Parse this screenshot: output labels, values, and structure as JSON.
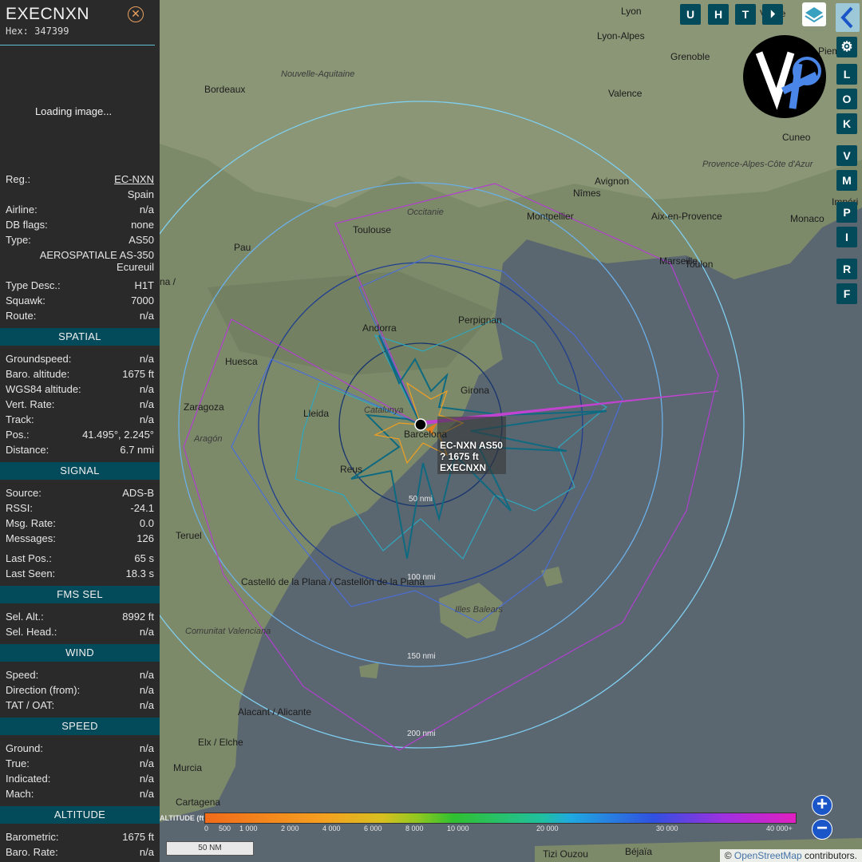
{
  "aircraft": {
    "callsign": "EXECNXN",
    "hex": "Hex: 347399",
    "loading": "Loading image..."
  },
  "info": {
    "reg_k": "Reg.:",
    "reg_v": "EC-NXN",
    "country": "Spain",
    "airline_k": "Airline:",
    "airline_v": "n/a",
    "dbflags_k": "DB flags:",
    "dbflags_v": "none",
    "type_k": "Type:",
    "type_v": "AS50",
    "type_full": "AEROSPATIALE AS-350\nEcureuil",
    "typedesc_k": "Type Desc.:",
    "typedesc_v": "H1T",
    "squawk_k": "Squawk:",
    "squawk_v": "7000",
    "route_k": "Route:",
    "route_v": "n/a"
  },
  "spatial": {
    "title": "SPATIAL",
    "rows": [
      [
        "Groundspeed:",
        "n/a"
      ],
      [
        "Baro. altitude:",
        "1675 ft"
      ],
      [
        "WGS84 altitude:",
        "n/a"
      ],
      [
        "Vert. Rate:",
        "n/a"
      ],
      [
        "Track:",
        "n/a"
      ],
      [
        "Pos.:",
        "41.495°, 2.245°"
      ],
      [
        "Distance:",
        "6.7 nmi"
      ]
    ]
  },
  "signal": {
    "title": "SIGNAL",
    "rows": [
      [
        "Source:",
        "ADS-B"
      ],
      [
        "RSSI:",
        "-24.1"
      ],
      [
        "Msg. Rate:",
        "0.0"
      ],
      [
        "Messages:",
        "126"
      ],
      [
        "Last Pos.:",
        "65 s"
      ],
      [
        "Last Seen:",
        "18.3 s"
      ]
    ]
  },
  "fms": {
    "title": "FMS SEL",
    "rows": [
      [
        "Sel. Alt.:",
        "8992 ft"
      ],
      [
        "Sel. Head.:",
        "n/a"
      ]
    ]
  },
  "wind": {
    "title": "WIND",
    "rows": [
      [
        "Speed:",
        "n/a"
      ],
      [
        "Direction (from):",
        "n/a"
      ],
      [
        "TAT / OAT:",
        "n/a"
      ]
    ]
  },
  "speed": {
    "title": "SPEED",
    "rows": [
      [
        "Ground:",
        "n/a"
      ],
      [
        "True:",
        "n/a"
      ],
      [
        "Indicated:",
        "n/a"
      ],
      [
        "Mach:",
        "n/a"
      ]
    ]
  },
  "altitude": {
    "title": "ALTITUDE",
    "rows": [
      [
        "Barometric:",
        "1675 ft"
      ],
      [
        "Baro. Rate:",
        "n/a"
      ]
    ]
  },
  "map": {
    "places": [
      "Lyon",
      "Grenoble",
      "Valence",
      "Bordeaux",
      "Nouvelle-Aquitaine",
      "Avignon",
      "Nîmes",
      "Provence-Alpes-Côte d'Azur",
      "Cuneo",
      "Toulouse",
      "Occitanie",
      "Montpellier",
      "Aix-en-Provence",
      "Marseille",
      "Toulon",
      "Monaco",
      "Pau",
      "Andorra",
      "Perpignan",
      "Huesca",
      "Girona",
      "Zaragoza",
      "Lleida",
      "Catalunya",
      "Aragón",
      "Barcelona",
      "Reus",
      "Teruel",
      "Castelló de la Plana / Castellón de la Plana",
      "Comunitat Valenciana",
      "Illes Balears",
      "Alacant / Alicante",
      "Elx / Elche",
      "Murcia",
      "Cartagena",
      "Tizi Ouzou",
      "Béjaïa",
      "Piem",
      "Impéri",
      "na /",
      "Lyon-Alpes",
      "Vallée"
    ],
    "ranges": [
      "50 nmi",
      "100 nmi",
      "150 nmi",
      "200 nmi"
    ],
    "label": {
      "line1": "EC-NXN AS50",
      "line2": "?   1675 ft",
      "line3": "EXECNXN"
    },
    "top_buttons": [
      "U",
      "H",
      "T"
    ],
    "side_buttons": [
      "L",
      "O",
      "K",
      "V",
      "M",
      "P",
      "I",
      "R",
      "F"
    ],
    "legend_title": "ALTITUDE (ft)",
    "legend_ticks": [
      "0",
      "500",
      "1 000",
      "2 000",
      "4 000",
      "6 000",
      "8 000",
      "10 000",
      "20 000",
      "30 000",
      "40 000+"
    ],
    "scale": "50 NM",
    "attribution_pre": "© ",
    "attribution_link": "OpenStreetMap",
    "attribution_post": " contributors.",
    "zoom_in": "+",
    "zoom_out": "−"
  },
  "colors": {
    "accent": "#034a5a",
    "link": "#5ec0d0",
    "zoom": "#1b56c8"
  },
  "icons": [
    "close-icon",
    "replay-icon",
    "layers-icon",
    "collapse-icon",
    "settings-icon",
    "aircraft-icon",
    "logo-icon"
  ]
}
